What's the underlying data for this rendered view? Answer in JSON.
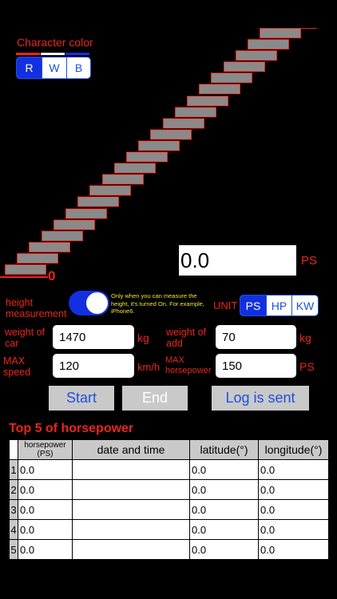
{
  "character_color": {
    "title": "Character color",
    "options": [
      "R",
      "W",
      "B"
    ],
    "selected": "R",
    "colors": [
      "#e8261c",
      "#ffffff",
      "#1230e0"
    ]
  },
  "stairs": {
    "height_value": "0",
    "step_count": 22,
    "step_fill": "#8a8a8a",
    "step_border": "#e8261c"
  },
  "power": {
    "value": "0.0",
    "unit_label": "PS"
  },
  "height_measurement": {
    "label": "height measurement",
    "toggle_on": true,
    "note": "Only when you can measure the height, it's turned On. For example, iPhone6."
  },
  "unit": {
    "label": "UNIT",
    "options": [
      "PS",
      "HP",
      "KW"
    ],
    "selected": "PS"
  },
  "fields": {
    "weight_of_car": {
      "label": "weight of car",
      "value": "1470",
      "unit": "kg"
    },
    "weight_of_add": {
      "label": "weight of add",
      "value": "70",
      "unit": "kg"
    },
    "max_speed": {
      "label": "MAX speed",
      "value": "120",
      "unit": "km/h"
    },
    "max_horsepower": {
      "label": "MAX horsepower",
      "value": "150",
      "unit": "PS"
    }
  },
  "buttons": {
    "start": "Start",
    "end": "End",
    "log_sent": "Log is sent"
  },
  "top5": {
    "title": "Top 5 of horsepower",
    "headers": [
      "horsepower (PS)",
      "date and time",
      "latitude(°)",
      "longitude(°)"
    ],
    "rows": [
      {
        "n": "1",
        "hp": "0.0",
        "dt": "",
        "lat": "0.0",
        "lon": "0.0"
      },
      {
        "n": "2",
        "hp": "0.0",
        "dt": "",
        "lat": "0.0",
        "lon": "0.0"
      },
      {
        "n": "3",
        "hp": "0.0",
        "dt": "",
        "lat": "0.0",
        "lon": "0.0"
      },
      {
        "n": "4",
        "hp": "0.0",
        "dt": "",
        "lat": "0.0",
        "lon": "0.0"
      },
      {
        "n": "5",
        "hp": "0.0",
        "dt": "",
        "lat": "0.0",
        "lon": "0.0"
      }
    ]
  }
}
